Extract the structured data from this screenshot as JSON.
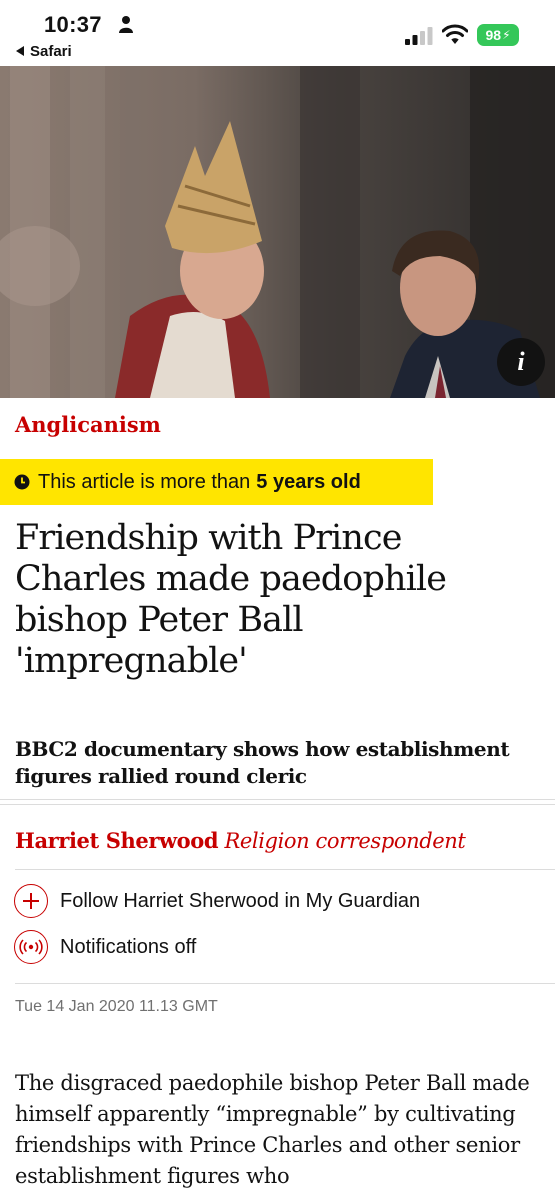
{
  "status_bar": {
    "time": "10:37",
    "back_app": "Safari",
    "battery": "98",
    "battery_color": "#34c759"
  },
  "hero": {
    "info_label": "i"
  },
  "article": {
    "kicker": "Anglicanism",
    "age_notice_prefix": "This article is more than",
    "age_notice_bold": "5 years old",
    "headline": "Friendship with Prince Charles made paedophile bishop Peter Ball 'impregnable'",
    "standfirst": "BBC2 documentary shows how establishment figures rallied round cleric",
    "byline_author": "Harriet Sherwood",
    "byline_role": "Religion correspondent",
    "follow_label": "Follow Harriet Sherwood in My Guardian",
    "notifications_label": "Notifications off",
    "dateline": "Tue 14 Jan 2020 11.13 GMT",
    "body_first_paragraph": "The disgraced paedophile bishop Peter Ball made himself apparently “impregnable” by cultivating friendships with Prince Charles and other senior establishment figures who"
  },
  "colors": {
    "accent_red": "#c70000",
    "age_badge_yellow": "#ffe500",
    "text": "#121212",
    "muted": "#707070"
  },
  "icons": {
    "status": [
      "person-icon",
      "signal-icon",
      "wifi-icon",
      "battery-icon"
    ],
    "article": [
      "clock-icon",
      "plus-circle-icon",
      "notification-off-icon",
      "info-icon"
    ]
  }
}
